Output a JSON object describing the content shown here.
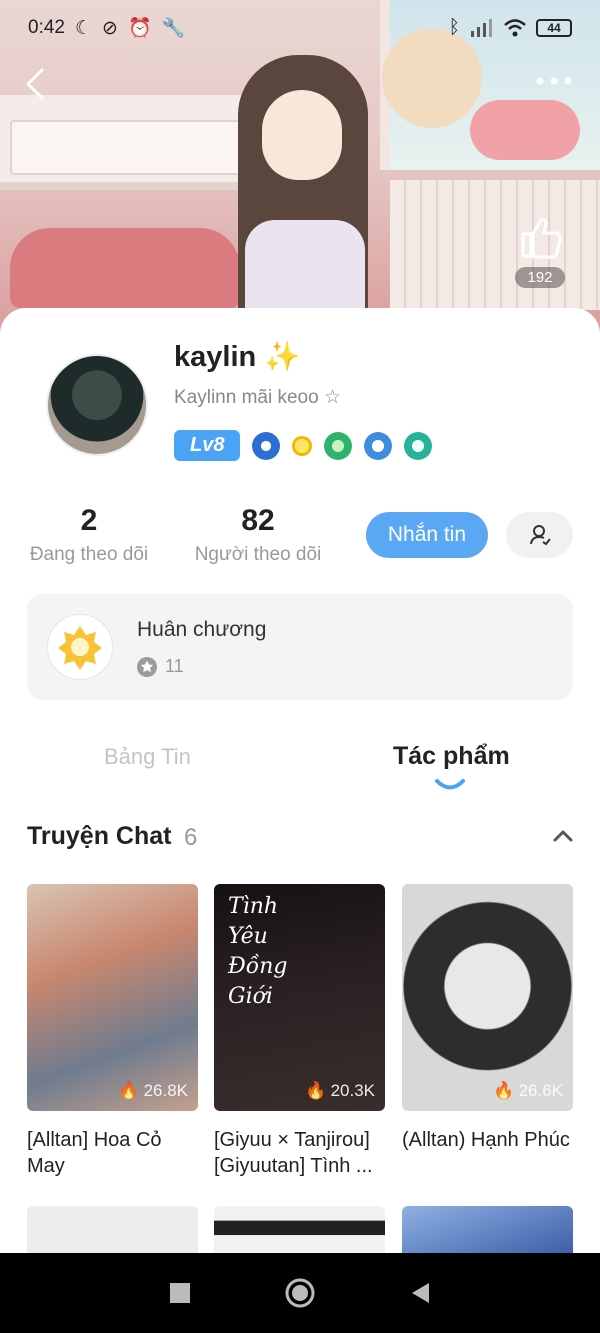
{
  "status_bar": {
    "time": "0:42",
    "battery": "44",
    "icons": [
      "moon-icon",
      "mute-icon",
      "alarm-icon",
      "app-icon",
      "wrench-icon",
      "twitter-icon",
      "bluetooth-icon",
      "signal-icon",
      "wifi-icon"
    ]
  },
  "header": {
    "back_icon": "back-arrow-icon",
    "more_icon": "more-dots-icon",
    "like_count": "192"
  },
  "profile": {
    "username": "kaylin ✨",
    "bio": "Kaylinn mãi keoo ☆",
    "level": "Lv8",
    "badges": [
      "badge-blue-drop",
      "badge-gold-coin",
      "badge-green-shield",
      "badge-blue-crown",
      "badge-teal-gem"
    ]
  },
  "stats": {
    "following_count": "2",
    "following_label": "Đang theo dõi",
    "followers_count": "82",
    "followers_label": "Người theo dõi"
  },
  "actions": {
    "message_label": "Nhắn tin",
    "follow_icon": "add-friend-icon"
  },
  "medals": {
    "title": "Huân chương",
    "count": "11"
  },
  "tabs": [
    {
      "label": "Bảng Tin",
      "active": false
    },
    {
      "label": "Tác phẩm",
      "active": true
    }
  ],
  "section": {
    "title": "Truyện Chat",
    "count": "6"
  },
  "stories": [
    {
      "title": "[Alltan] Hoa Cỏ May",
      "views": "26.8K"
    },
    {
      "title": "[Giyuu × Tanjirou] [Giyuutan] Tình ...",
      "views": "20.3K",
      "cover_text": "Tình\nYêu\nĐồng\nGiới"
    },
    {
      "title": "(Alltan) Hạnh Phúc",
      "views": "26.6K"
    }
  ],
  "colors": {
    "accent": "#5aa8f3",
    "level_badge": "#4aa3f5",
    "muted_text": "#999999"
  }
}
